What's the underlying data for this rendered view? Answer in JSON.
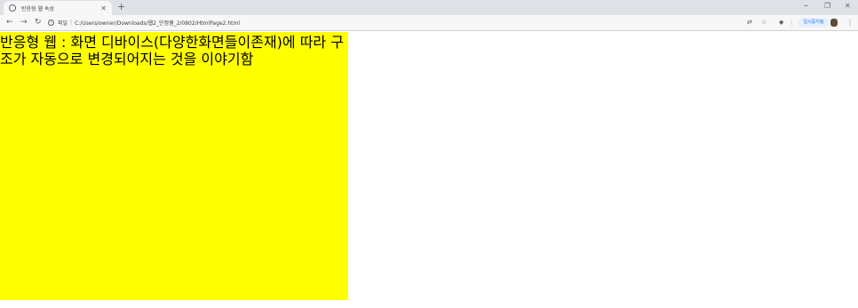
{
  "browser": {
    "tab": {
      "title": "반응형 웹 속성",
      "close_icon": "close-icon"
    },
    "new_tab_label": "+",
    "address": {
      "security_label": "파일",
      "url": "C:/Users/owner/Downloads/웹2_민정쌤_2/0802/HtmlPage2.html"
    },
    "profile_button_label": "일시중지됨",
    "colors": {
      "tabbar": "#dee1e6",
      "toolbar": "#f7f7f7",
      "accent": "#1a73e8"
    }
  },
  "page": {
    "text": "반응형 웹 : 화면 디바이스(다양한화면들이존재)에 따라 구조가 자동으로 변경되어지는 것을 이야기함",
    "colors": {
      "box_background": "#ffff00",
      "text": "#000000"
    }
  }
}
